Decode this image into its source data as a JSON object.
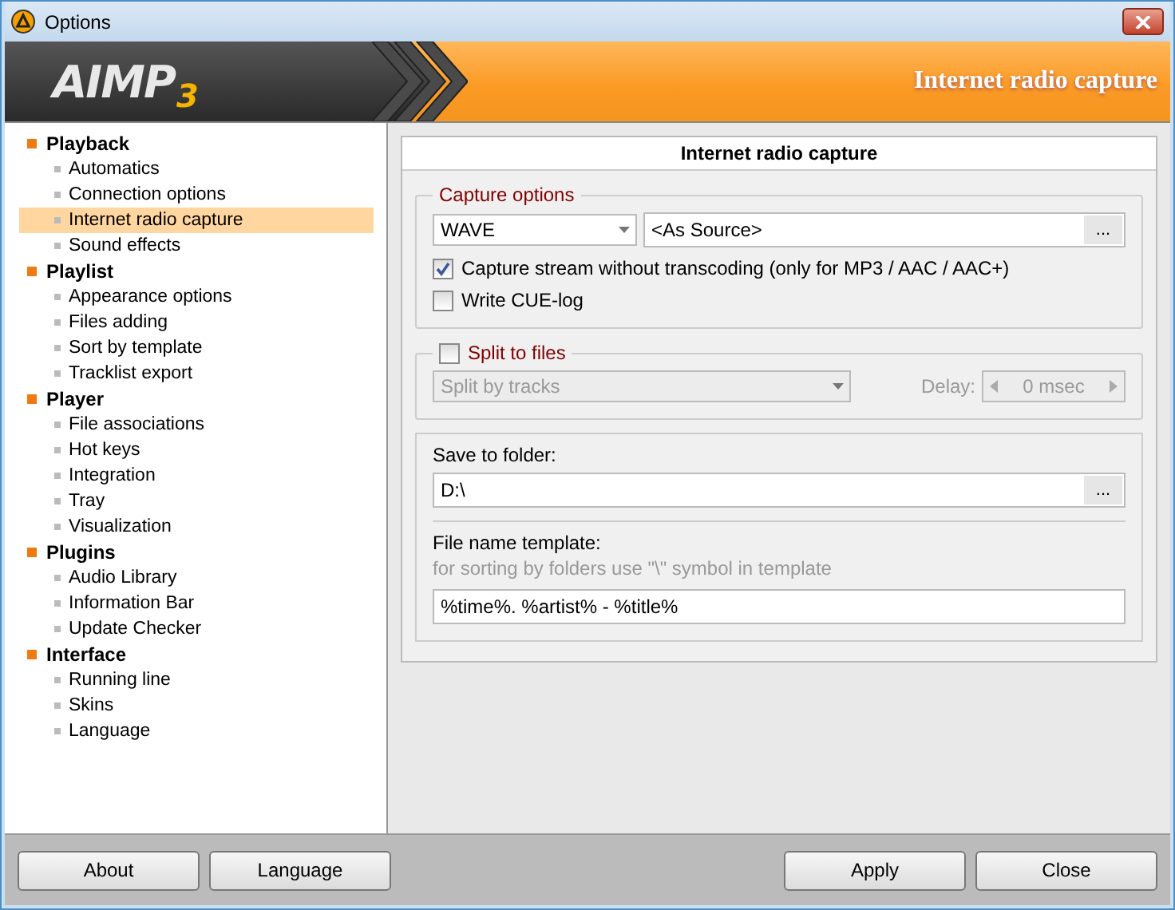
{
  "window": {
    "title": "Options"
  },
  "header": {
    "logo": "AIMP",
    "logo_version": "3",
    "title": "Internet radio capture"
  },
  "sidebar": {
    "items": [
      {
        "label": "Playback",
        "selected": false,
        "children": [
          {
            "label": "Automatics",
            "selected": false
          },
          {
            "label": "Connection options",
            "selected": false
          },
          {
            "label": "Internet radio capture",
            "selected": true
          },
          {
            "label": "Sound effects",
            "selected": false
          }
        ]
      },
      {
        "label": "Playlist",
        "selected": false,
        "children": [
          {
            "label": "Appearance options",
            "selected": false
          },
          {
            "label": "Files adding",
            "selected": false
          },
          {
            "label": "Sort by template",
            "selected": false
          },
          {
            "label": "Tracklist export",
            "selected": false
          }
        ]
      },
      {
        "label": "Player",
        "selected": false,
        "children": [
          {
            "label": "File associations",
            "selected": false
          },
          {
            "label": "Hot keys",
            "selected": false
          },
          {
            "label": "Integration",
            "selected": false
          },
          {
            "label": "Tray",
            "selected": false
          },
          {
            "label": "Visualization",
            "selected": false
          }
        ]
      },
      {
        "label": "Plugins",
        "selected": false,
        "children": [
          {
            "label": "Audio Library",
            "selected": false
          },
          {
            "label": "Information Bar",
            "selected": false
          },
          {
            "label": "Update Checker",
            "selected": false
          }
        ]
      },
      {
        "label": "Interface",
        "selected": false,
        "children": [
          {
            "label": "Running line",
            "selected": false
          },
          {
            "label": "Skins",
            "selected": false
          },
          {
            "label": "Language",
            "selected": false
          }
        ]
      }
    ]
  },
  "panel": {
    "title": "Internet radio capture",
    "capture": {
      "legend": "Capture options",
      "format": "WAVE",
      "quality": "<As Source>",
      "browse": "...",
      "options": [
        {
          "label": "Capture stream without transcoding (only for MP3 / AAC / AAC+)",
          "checked": true
        },
        {
          "label": "Write CUE-log",
          "checked": false
        }
      ]
    },
    "split": {
      "label": "Split to files",
      "checked": false,
      "disabled": true,
      "mode": "Split by tracks",
      "delay_label": "Delay:",
      "delay_value": "0 msec"
    },
    "save": {
      "folder_label": "Save to folder:",
      "folder": "D:\\",
      "browse": "...",
      "template_label": "File name template:",
      "template_hint": "for sorting by folders use \"\\\" symbol in template",
      "template": "%time%. %artist% - %title%"
    }
  },
  "footer": {
    "left_buttons": [
      "About",
      "Language"
    ],
    "right_buttons": [
      "Apply",
      "Close"
    ]
  }
}
